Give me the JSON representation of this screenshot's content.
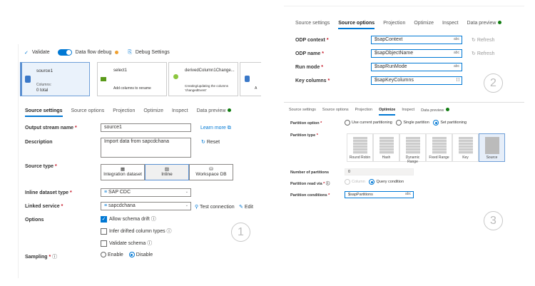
{
  "panel1": {
    "toolbar": {
      "validate": "Validate",
      "debug": "Data flow debug",
      "debug_settings": "Debug Settings"
    },
    "nodes": [
      {
        "title": "source1",
        "sub1": "Columns:",
        "sub2": "0 total"
      },
      {
        "title": "select1",
        "sub1": "Add columns to rename"
      },
      {
        "title": "derivedColumn1Change...",
        "sub1": "Creating/updating the columns",
        "sub2": "'changedEvent'"
      },
      {
        "title": "A"
      }
    ],
    "tabs": [
      "Source settings",
      "Source options",
      "Projection",
      "Optimize",
      "Inspect",
      "Data preview"
    ],
    "output_stream_label": "Output stream name",
    "output_stream_value": "source1",
    "learn_more": "Learn more",
    "description_label": "Description",
    "description_value": "Import data from sapcdchana",
    "reset": "Reset",
    "source_type_label": "Source type",
    "source_types": [
      "Integration dataset",
      "Inline",
      "Workspace DB"
    ],
    "inline_type_label": "Inline dataset type",
    "inline_type_value": "SAP CDC",
    "linked_service_label": "Linked service",
    "linked_service_value": "sapcdchana",
    "test_connection": "Test connection",
    "edit": "Edit",
    "options_label": "Options",
    "options": [
      "Allow schema drift",
      "Infer drifted column types",
      "Validate schema"
    ],
    "sampling_label": "Sampling",
    "sampling_options": [
      "Enable",
      "Disable"
    ],
    "step": "1"
  },
  "panel2": {
    "tabs": [
      "Source settings",
      "Source options",
      "Projection",
      "Optimize",
      "Inspect",
      "Data preview"
    ],
    "rows": [
      {
        "label": "ODP context",
        "value": "$sapContext",
        "tail": "abc",
        "refresh": "Refresh"
      },
      {
        "label": "ODP name",
        "value": "$sapObjectName",
        "tail": "abc",
        "refresh": "Refresh"
      },
      {
        "label": "Run mode",
        "value": "$sapRunMode",
        "tail": "abc"
      },
      {
        "label": "Key columns",
        "value": "$sapKeyColumns",
        "tail": "[ ]"
      }
    ],
    "step": "2"
  },
  "panel3": {
    "tabs": [
      "Source settings",
      "Source options",
      "Projection",
      "Optimize",
      "Inspect",
      "Data preview"
    ],
    "partition_option_label": "Partition option",
    "partition_options": [
      "Use current partitioning",
      "Single partition",
      "Set partitioning"
    ],
    "partition_type_label": "Partition type",
    "partition_types": [
      "Round Robin",
      "Hash",
      "Dynamic Range",
      "Fixed Range",
      "Key",
      "Source"
    ],
    "num_partitions_label": "Number of partitions",
    "num_partitions_value": "0",
    "read_via_label": "Partition read via",
    "read_via_options": [
      "Column",
      "Query condition"
    ],
    "conditions_label": "Partition conditions",
    "conditions_value": "$sapPartitions",
    "conditions_tail": "abc",
    "step": "3"
  }
}
